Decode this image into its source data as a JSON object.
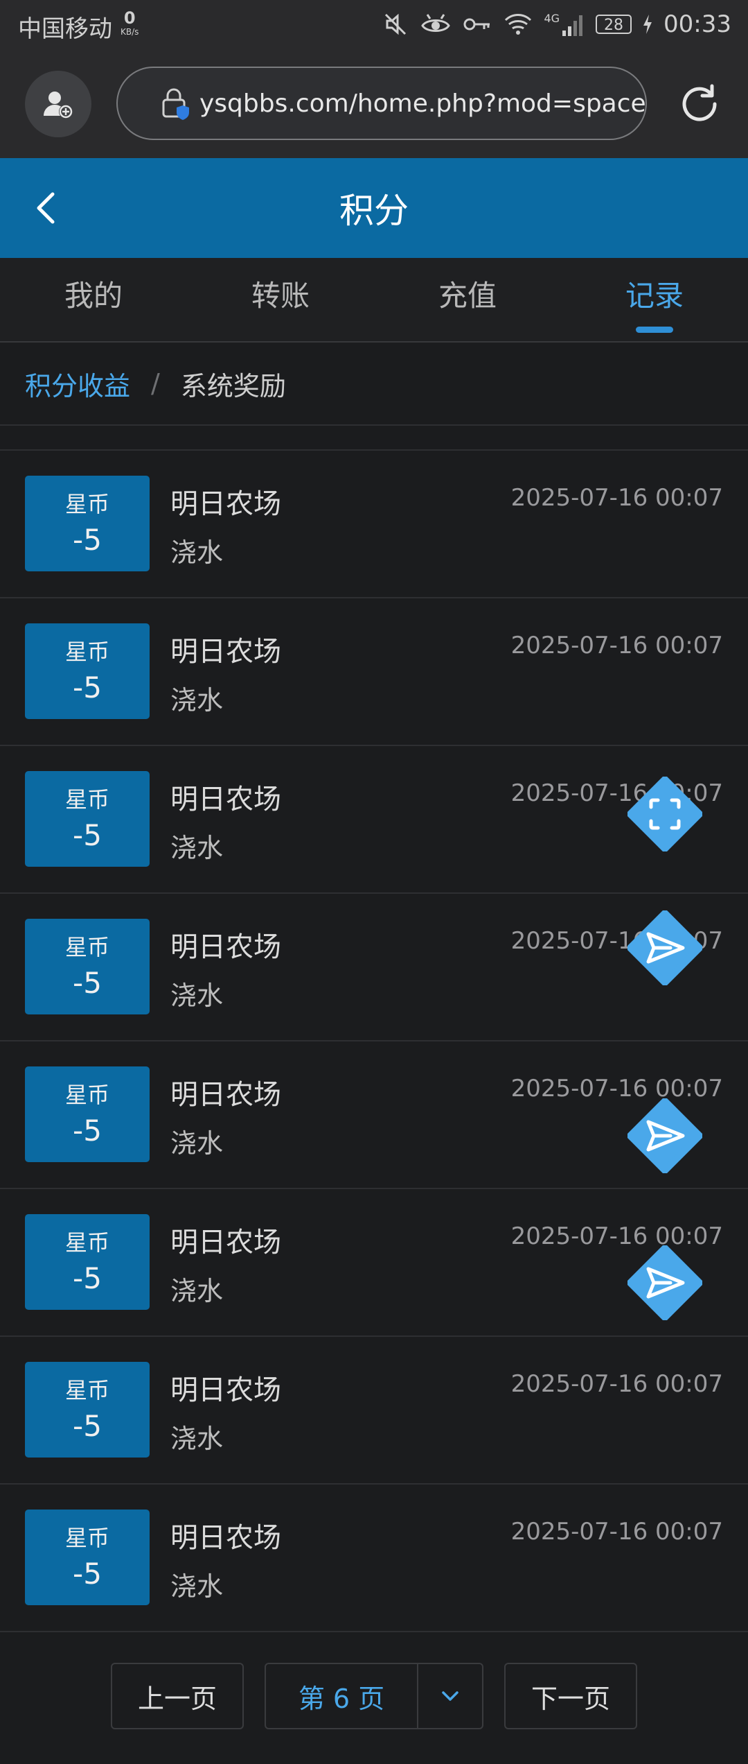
{
  "status_bar": {
    "carrier": "中国移动",
    "net_speed_value": "0",
    "net_speed_unit": "KB/s",
    "network_type": "4G",
    "battery": "28",
    "time": "00:33"
  },
  "browser": {
    "url": "ysqbbs.com/home.php?mod=spacecp"
  },
  "header": {
    "title": "积分"
  },
  "tabs": [
    {
      "label": "我的",
      "active": false
    },
    {
      "label": "转账",
      "active": false
    },
    {
      "label": "充值",
      "active": false
    },
    {
      "label": "记录",
      "active": true
    }
  ],
  "breadcrumb": {
    "link": "积分收益",
    "separator": "/",
    "current": "系统奖励"
  },
  "records": [
    {
      "badge_label": "星币",
      "badge_value": "-5",
      "title": "明日农场",
      "subtitle": "浇水",
      "time": "2025-07-16 00:07"
    },
    {
      "badge_label": "星币",
      "badge_value": "-5",
      "title": "明日农场",
      "subtitle": "浇水",
      "time": "2025-07-16 00:07"
    },
    {
      "badge_label": "星币",
      "badge_value": "-5",
      "title": "明日农场",
      "subtitle": "浇水",
      "time": "2025-07-16 00:07"
    },
    {
      "badge_label": "星币",
      "badge_value": "-5",
      "title": "明日农场",
      "subtitle": "浇水",
      "time": "2025-07-16 00:07"
    },
    {
      "badge_label": "星币",
      "badge_value": "-5",
      "title": "明日农场",
      "subtitle": "浇水",
      "time": "2025-07-16 00:07"
    },
    {
      "badge_label": "星币",
      "badge_value": "-5",
      "title": "明日农场",
      "subtitle": "浇水",
      "time": "2025-07-16 00:07"
    },
    {
      "badge_label": "星币",
      "badge_value": "-5",
      "title": "明日农场",
      "subtitle": "浇水",
      "time": "2025-07-16 00:07"
    },
    {
      "badge_label": "星币",
      "badge_value": "-5",
      "title": "明日农场",
      "subtitle": "浇水",
      "time": "2025-07-16 00:07"
    }
  ],
  "pagination": {
    "prev_label": "上一页",
    "current_page": "第 6 页",
    "next_label": "下一页"
  },
  "floating_buttons": [
    {
      "icon": "screenshot-frame-icon"
    },
    {
      "icon": "send-icon"
    },
    {
      "icon": "send-icon"
    },
    {
      "icon": "send-icon"
    }
  ],
  "colors": {
    "accent": "#0b6aa2",
    "link": "#4aa8ea",
    "background": "#1b1c1e",
    "fab": "#4aa8ea"
  }
}
